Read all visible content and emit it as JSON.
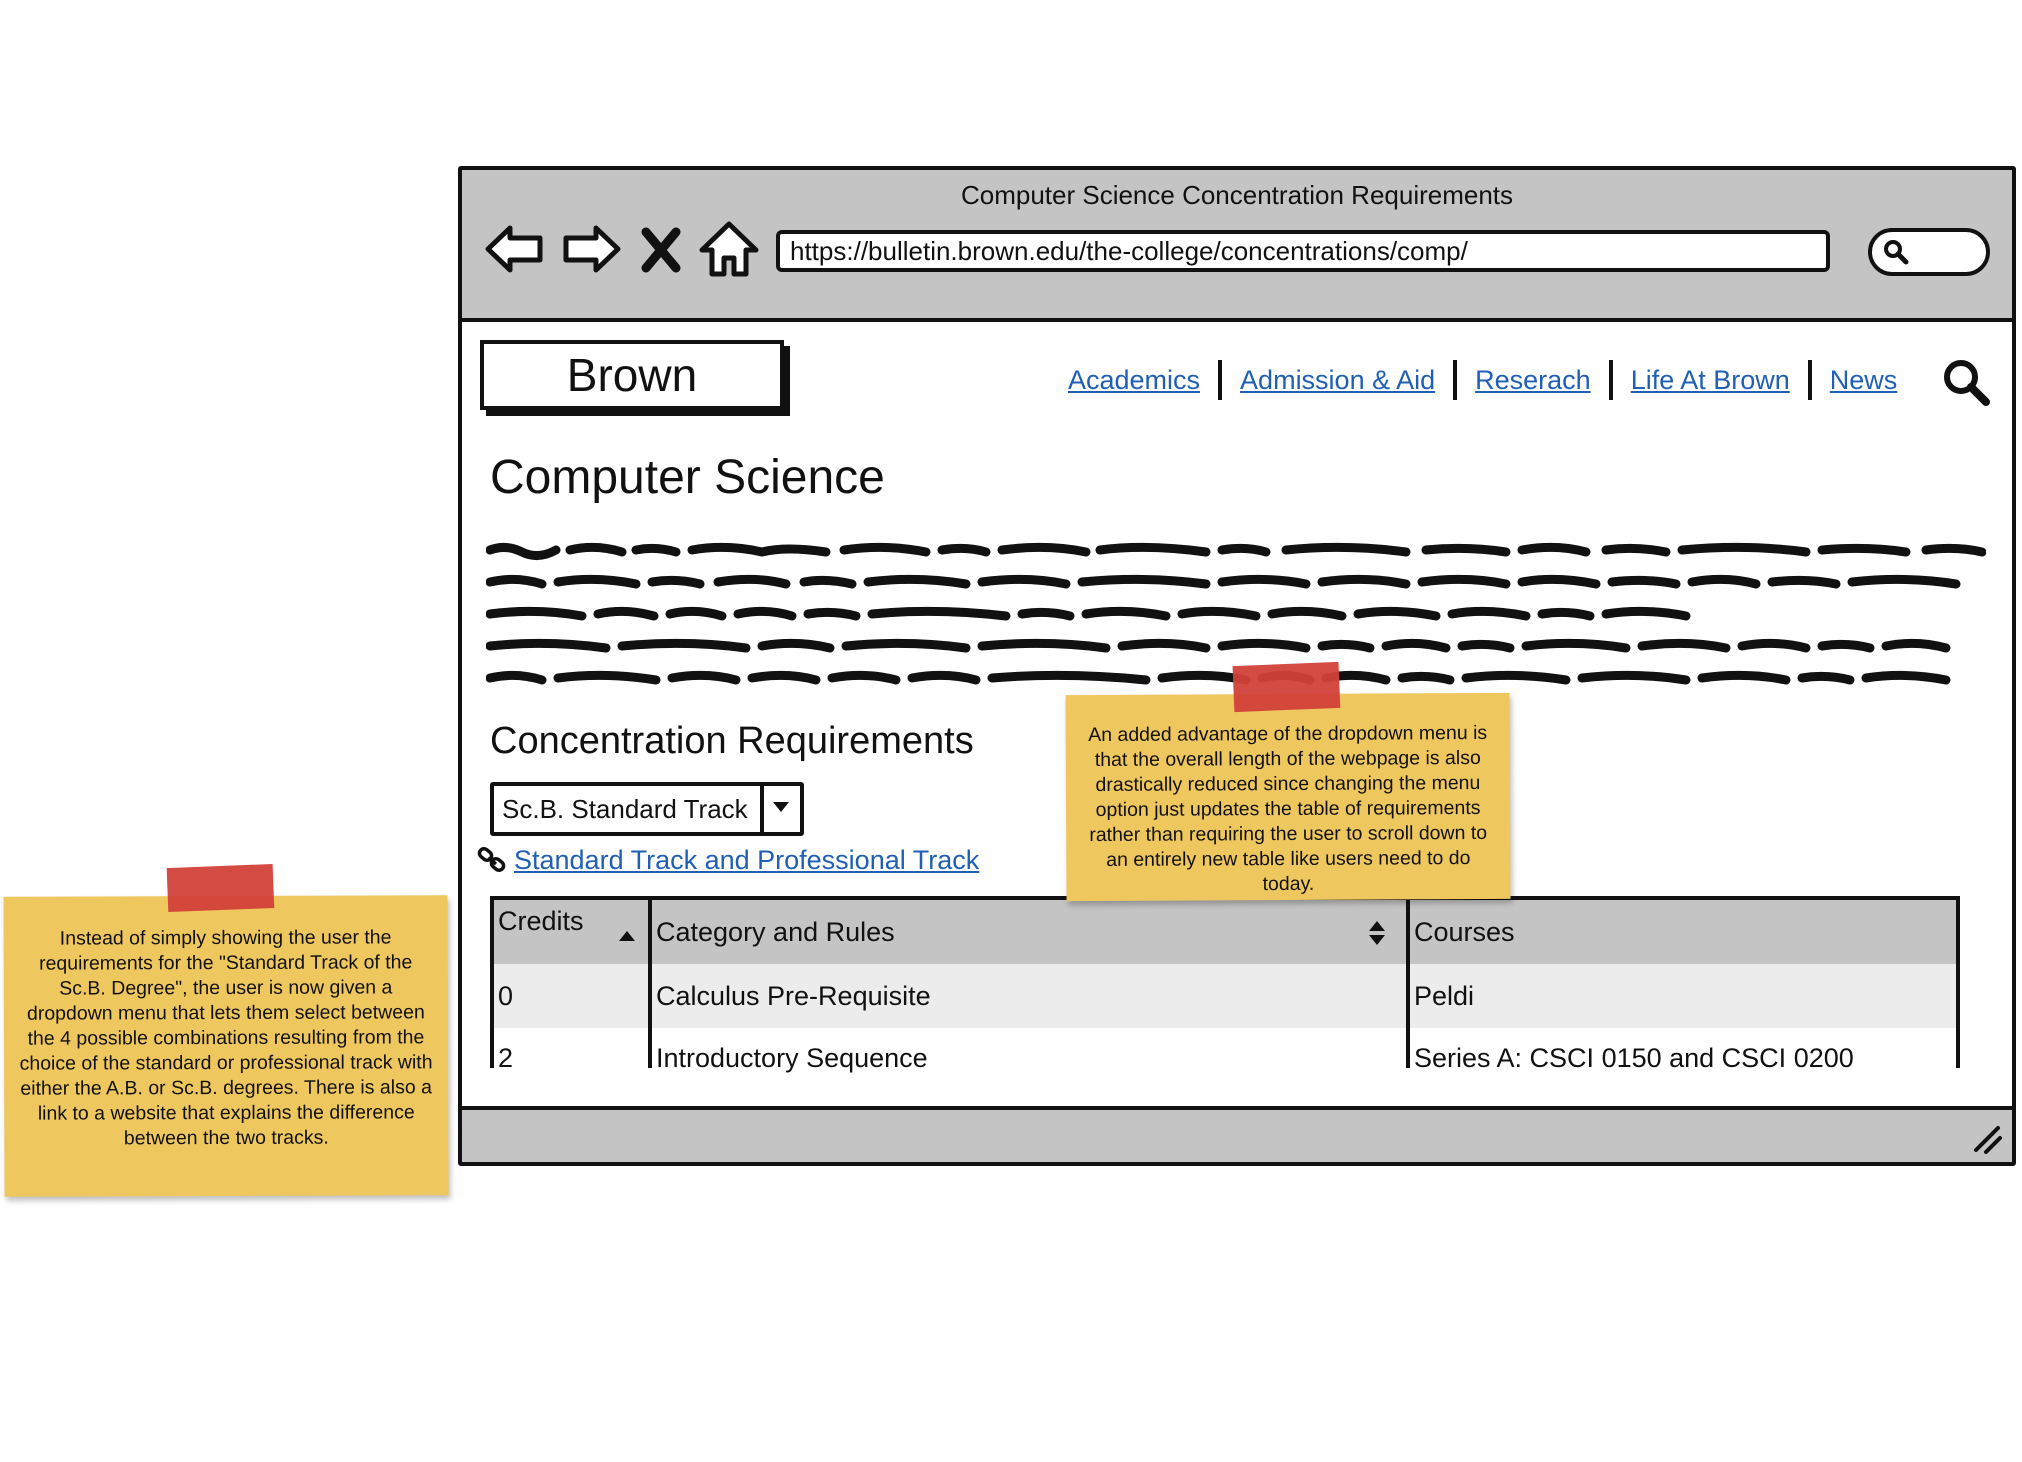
{
  "window": {
    "title": "Computer Science Concentration Requirements",
    "url": "https://bulletin.brown.edu/the-college/concentrations/comp/"
  },
  "site": {
    "logo": "Brown",
    "nav": [
      "Academics",
      "Admission & Aid",
      "Reserach",
      "Life At Brown",
      "News"
    ]
  },
  "page": {
    "title": "Computer Science",
    "section_title": "Concentration Requirements",
    "track_select": "Sc.B. Standard Track",
    "track_link": "Standard Track and Professional Track"
  },
  "table": {
    "headers": [
      "Credits",
      "Category and Rules",
      "Courses"
    ],
    "rows": [
      [
        "0",
        "Calculus Pre-Requisite",
        "Peldi"
      ],
      [
        "2",
        "Introductory Sequence",
        "Series A: CSCI 0150 and CSCI 0200"
      ]
    ]
  },
  "notes": {
    "left": "Instead of simply showing the user the requirements for the \"Standard Track of the Sc.B. Degree\", the user is now given a dropdown menu that lets them select between the 4 possible combinations resulting from the choice of the standard or professional track with either the A.B. or Sc.B. degrees. There is also a link to a website that explains the difference between the two tracks.",
    "right": "An added advantage of the dropdown menu is that the overall length of the webpage is also drastically reduced since changing the menu option just updates the table of requirements rather than requiring the user to scroll down to an entirely new table like users need to do today."
  },
  "colors": {
    "chrome": "#c4c4c4",
    "link": "#1f5fb5",
    "note": "#efc75f",
    "tape": "#d2413a"
  },
  "icons": [
    "back-arrow-icon",
    "forward-arrow-icon",
    "stop-icon",
    "home-icon",
    "search-icon",
    "link-icon",
    "dropdown-arrow-icon",
    "sort-icon",
    "resize-grip-icon"
  ]
}
